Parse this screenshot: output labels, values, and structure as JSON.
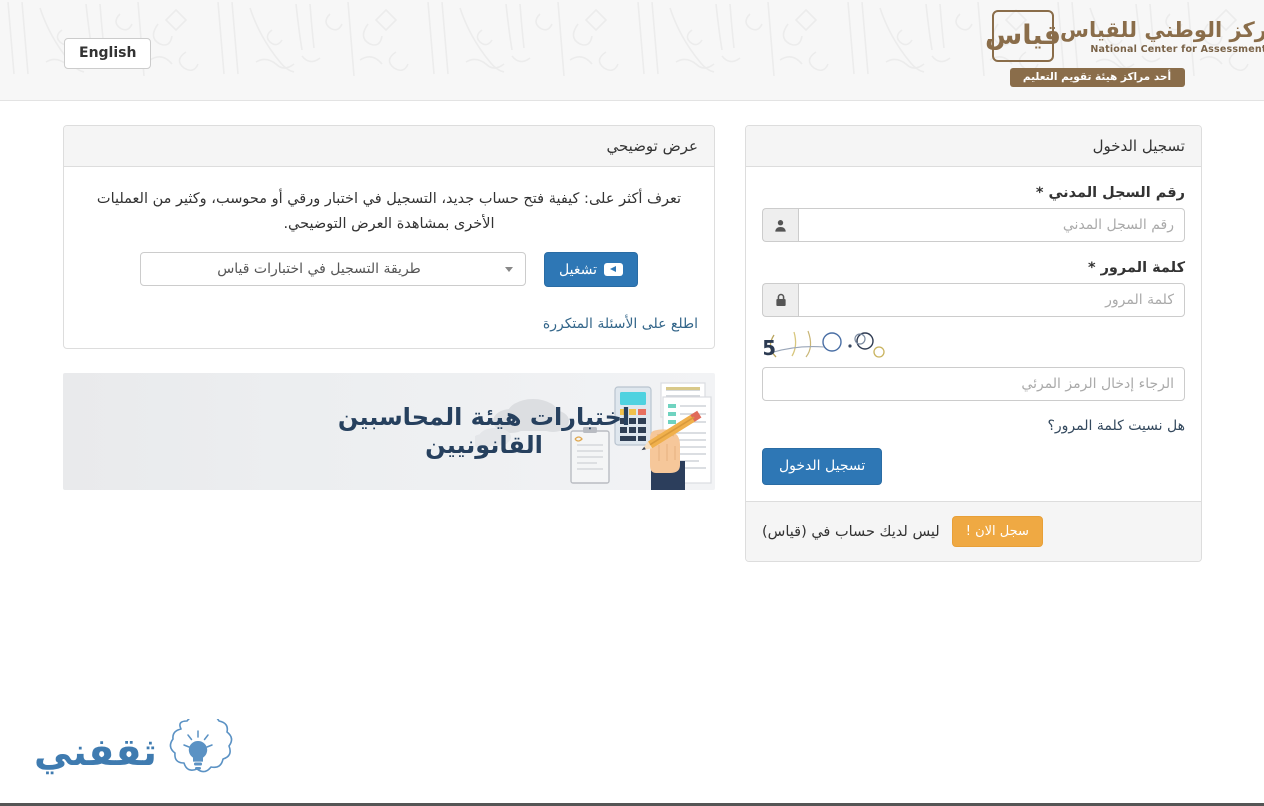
{
  "header": {
    "lang_button": "English",
    "logo": {
      "mark_text": "قياس",
      "arabic_name": "المركز الوطني للقياس",
      "english_name": "National Center for Assessment",
      "ribbon": "أحد مراكز هيئة تقويم التعليم"
    }
  },
  "login": {
    "title": "تسجيل الدخول",
    "id_label": "رقم السجل المدني *",
    "id_placeholder": "رقم السجل المدني",
    "id_value": "",
    "id_icon": "user-icon",
    "password_label": "كلمة المرور *",
    "password_placeholder": "كلمة المرور",
    "password_value": "",
    "password_icon": "lock-icon",
    "captcha_text": "2475",
    "captcha_placeholder": "الرجاء إدخال الرمز المرئي",
    "captcha_value": "",
    "forgot_link": "هل نسيت كلمة المرور؟",
    "submit_label": "تسجيل الدخول",
    "footer_text": "ليس لديك حساب في (قياس)",
    "register_label": "سجل الان !"
  },
  "demo": {
    "title": "عرض توضيحي",
    "description": "تعرف أكثر على: كيفية فتح حساب جديد، التسجيل في اختبار ورقي أو محوسب، وكثير من العمليات الأخرى بمشاهدة العرض التوضيحي.",
    "select_value": "طريقة التسجيل في اختبارات قياس",
    "select_icon": "chevron-down-icon",
    "play_label": "تشغيل",
    "play_icon": "youtube-play-icon",
    "faq_link": "اطلع على الأسئلة المتكررة"
  },
  "banner": {
    "title": "اختبارات هيئة المحاسبين القانونيين",
    "illustration": "accounting-desk-illustration"
  },
  "watermark": {
    "brand": "ثقفني",
    "icon": "lightbulb-cloud-icon"
  },
  "colors": {
    "primary_blue": "#2e77b5",
    "accent_orange": "#efa943",
    "logo_brown": "#8a6d4a",
    "banner_navy": "#26405e",
    "watermark_blue": "#3f7bb0"
  }
}
